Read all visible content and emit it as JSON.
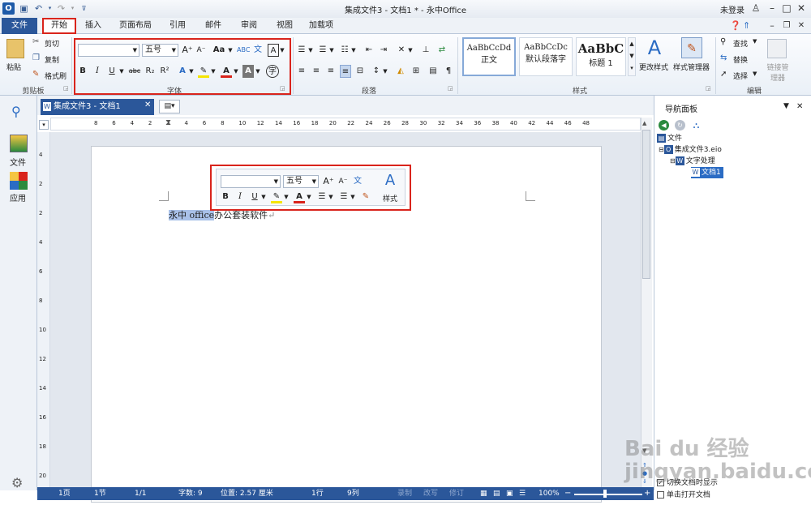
{
  "title_bar": {
    "title": "集成文件3 - 文档1 * - 永中Office",
    "login": "未登录"
  },
  "tabs": [
    "开始",
    "插入",
    "页面布局",
    "引用",
    "邮件",
    "审阅",
    "视图",
    "加载项"
  ],
  "file_tab": "文件",
  "clipboard": {
    "paste": "粘贴",
    "cut": "剪切",
    "copy": "复制",
    "format_painter": "格式刷",
    "group_label": "剪贴板"
  },
  "font": {
    "font_name": "",
    "font_size": "五号",
    "case": "Aa",
    "group_label": "字体"
  },
  "paragraph": {
    "group_label": "段落"
  },
  "styles": {
    "items": [
      {
        "preview": "AaBbCcDd",
        "name": "正文"
      },
      {
        "preview": "AaBbCcDc",
        "name": "默认段落字"
      },
      {
        "preview": "AaBbC",
        "name": "标题 1"
      }
    ],
    "change_styles": "更改样式",
    "style_manager": "样式管理器",
    "group_label": "样式"
  },
  "editing": {
    "find": "查找",
    "replace": "替换",
    "select": "选择",
    "link_manager": "链接管理器",
    "group_label": "编辑"
  },
  "left_bar": {
    "file": "文件",
    "apps": "应用"
  },
  "doc_tab": {
    "label": "集成文件3 - 文档1"
  },
  "ruler": {
    "labels": [
      "8",
      "6",
      "4",
      "2",
      "2",
      "4",
      "6",
      "8",
      "10",
      "12",
      "14",
      "16",
      "18",
      "20",
      "22",
      "24",
      "26",
      "28",
      "30",
      "32",
      "34",
      "36",
      "38",
      "40",
      "42",
      "44",
      "46",
      "48"
    ],
    "vlabels": [
      "4",
      "2",
      "2",
      "4",
      "6",
      "8",
      "10",
      "12",
      "14",
      "16",
      "18",
      "20"
    ]
  },
  "document": {
    "selected_text": "永中 office",
    "rest_text": "办公套装软件"
  },
  "mini_toolbar": {
    "font_size": "五号",
    "styles": "样式"
  },
  "nav_panel": {
    "title": "导航面板",
    "tree": [
      "文件",
      "集成文件3.eio",
      "文字处理",
      "文档1"
    ],
    "opt_switch": "切换文档时显示",
    "opt_click": "单击打开文档"
  },
  "status": {
    "page": "1页",
    "section": "1节",
    "pages": "1/1",
    "words": "字数: 9",
    "position": "位置: 2.57 厘米",
    "line": "1行",
    "col": "9列",
    "record": "录制",
    "overwrite": "改写",
    "revise": "修订",
    "zoom": "100%"
  },
  "watermark": "Bai du 经验 jingyan.baidu.com"
}
